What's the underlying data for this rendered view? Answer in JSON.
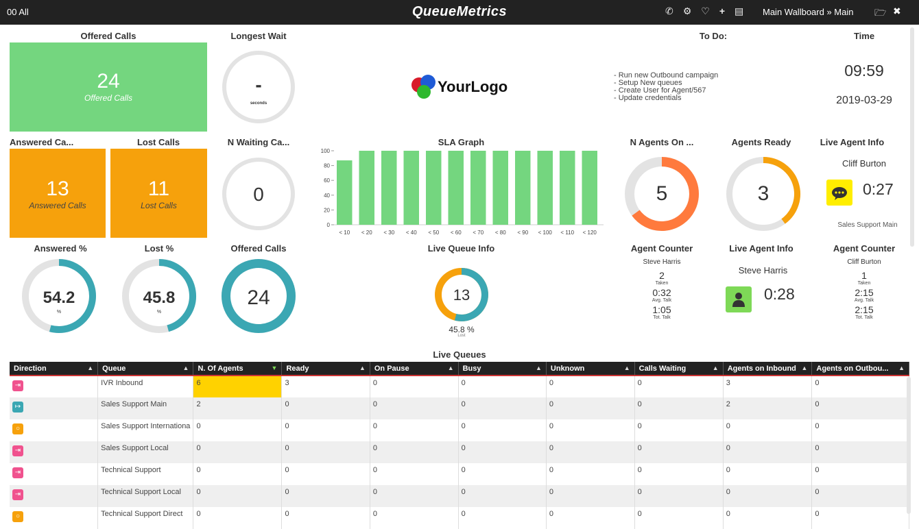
{
  "topbar": {
    "left_label": "00 All",
    "brand": "QueueMetrics",
    "icons": [
      "phone-icon",
      "gears-icon",
      "heart-icon",
      "plus-icon",
      "list-icon"
    ],
    "crumb": "Main Wallboard » Main",
    "open_glyph": "🗁",
    "close_glyph": "✖"
  },
  "offered_calls_tile": {
    "title": "Offered Calls",
    "value": "24",
    "sub": "Offered Calls",
    "color": "#74d67f"
  },
  "longest_wait": {
    "title": "Longest Wait",
    "value": "-",
    "unit": "seconds"
  },
  "logo": {
    "text": "YourLogo"
  },
  "todo": {
    "title": "To Do:",
    "items": [
      "- Run new Outbound campaign",
      "- Setup New queues",
      "- Create User for Agent/567",
      "- Update credentials"
    ]
  },
  "time": {
    "title": "Time",
    "clock": "09:59",
    "date": "2019-03-29"
  },
  "answered_tile": {
    "title": "Answered Ca...",
    "value": "13",
    "sub": "Answered Calls",
    "color": "#f6a10c"
  },
  "lost_tile": {
    "title": "Lost Calls",
    "value": "11",
    "sub": "Lost Calls",
    "color": "#f6a10c"
  },
  "n_waiting": {
    "title": "N Waiting Ca...",
    "value": "0"
  },
  "sla": {
    "title": "SLA Graph",
    "chart_data": {
      "type": "bar",
      "categories": [
        "< 10",
        "< 20",
        "< 30",
        "< 40",
        "< 50",
        "< 60",
        "< 70",
        "< 80",
        "< 90",
        "< 100",
        "< 110",
        "< 120"
      ],
      "values": [
        87,
        100,
        100,
        100,
        100,
        100,
        100,
        100,
        100,
        100,
        100,
        100
      ],
      "yticks": [
        "0",
        "20",
        "40",
        "60",
        "80",
        "100"
      ],
      "ylim": [
        0,
        100
      ],
      "color": "#74d67f"
    }
  },
  "n_agents_on": {
    "title": "N Agents On ...",
    "value": "5",
    "fraction": 0.65,
    "color": "#ff7a3d"
  },
  "agents_ready": {
    "title": "Agents Ready",
    "value": "3",
    "fraction": 0.4,
    "color": "#f6a10c"
  },
  "live_agent_1": {
    "title": "Live Agent Info",
    "name": "Cliff Burton",
    "timer": "0:27",
    "queue": "Sales Support Main",
    "icon_color": "#ffee00"
  },
  "answered_pct": {
    "title": "Answered %",
    "value": "54.2",
    "unit": "%",
    "fraction": 0.542,
    "color": "#3ba7b3"
  },
  "lost_pct": {
    "title": "Lost %",
    "value": "45.8",
    "unit": "%",
    "fraction": 0.458,
    "color": "#3ba7b3"
  },
  "offered_gauge": {
    "title": "Offered Calls",
    "value": "24",
    "fraction": 1.0,
    "color": "#3ba7b3"
  },
  "live_queue": {
    "title": "Live Queue Info",
    "value": "13",
    "pct": "45.8 %",
    "pct_label": "Lost",
    "fraction": 0.542
  },
  "agent_counter_1": {
    "title": "Agent Counter",
    "name": "Steve Harris",
    "taken": "2",
    "taken_label": "Taken",
    "avg_talk": "0:32",
    "avg_label": "Avg. Talk",
    "tot_talk": "1:05",
    "tot_label": "Tot. Talk"
  },
  "live_agent_2": {
    "title": "Live Agent Info",
    "name": "Steve Harris",
    "timer": "0:28",
    "icon_color": "#7ed957"
  },
  "agent_counter_2": {
    "title": "Agent Counter",
    "name": "Cliff Burton",
    "taken": "1",
    "taken_label": "Taken",
    "avg_talk": "2:15",
    "avg_label": "Avg. Talk",
    "tot_talk": "2:15",
    "tot_label": "Tot. Talk"
  },
  "live_queues": {
    "title": "Live Queues",
    "headers": [
      "Direction",
      "Queue",
      "N. Of Agents",
      "Ready",
      "On Pause",
      "Busy",
      "Unknown",
      "Calls Waiting",
      "Agents on Inbound",
      "Agents on Outbou..."
    ],
    "rows": [
      {
        "dir": "in",
        "color": "#f0528e",
        "glyph": "⇥",
        "cells": [
          "IVR Inbound",
          "6",
          "3",
          "0",
          "0",
          "0",
          "0",
          "3",
          "0"
        ]
      },
      {
        "dir": "out",
        "color": "#3ba7b3",
        "glyph": "↦",
        "cells": [
          "Sales Support Main",
          "2",
          "0",
          "0",
          "0",
          "0",
          "0",
          "2",
          "0"
        ]
      },
      {
        "dir": "mixed",
        "color": "#f6a10c",
        "glyph": "○",
        "cells": [
          "Sales Support Internationa",
          "0",
          "0",
          "0",
          "0",
          "0",
          "0",
          "0",
          "0"
        ]
      },
      {
        "dir": "in",
        "color": "#f0528e",
        "glyph": "⇥",
        "cells": [
          "Sales Support Local",
          "0",
          "0",
          "0",
          "0",
          "0",
          "0",
          "0",
          "0"
        ]
      },
      {
        "dir": "in",
        "color": "#f0528e",
        "glyph": "⇥",
        "cells": [
          "Technical Support",
          "0",
          "0",
          "0",
          "0",
          "0",
          "0",
          "0",
          "0"
        ]
      },
      {
        "dir": "in",
        "color": "#f0528e",
        "glyph": "⇥",
        "cells": [
          "Technical Support Local",
          "0",
          "0",
          "0",
          "0",
          "0",
          "0",
          "0",
          "0"
        ]
      },
      {
        "dir": "mixed",
        "color": "#f6a10c",
        "glyph": "○",
        "cells": [
          "Technical Support Direct",
          "0",
          "0",
          "0",
          "0",
          "0",
          "0",
          "0",
          "0"
        ]
      }
    ]
  }
}
